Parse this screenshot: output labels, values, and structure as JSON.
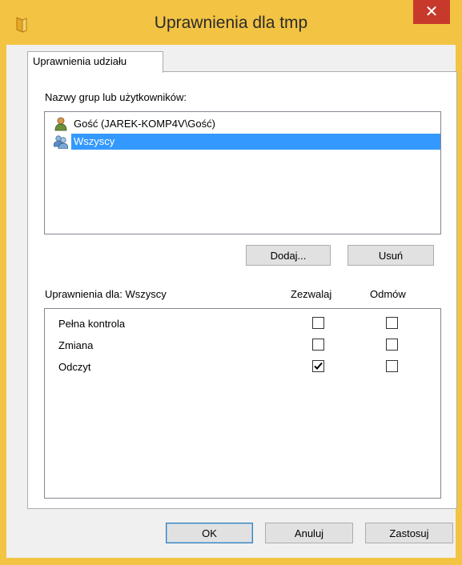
{
  "window": {
    "title": "Uprawnienia dla tmp",
    "close_glyph": "✕",
    "icon": "folder-icon"
  },
  "tabs": [
    {
      "label": "Uprawnienia udziału",
      "selected": true
    }
  ],
  "users_section": {
    "label": "Nazwy grup lub użytkowników:",
    "items": [
      {
        "label": "Gość (JAREK-KOMP4V\\Gość)",
        "icon": "user-icon",
        "selected": false
      },
      {
        "label": "Wszyscy",
        "icon": "group-icon",
        "selected": true
      }
    ],
    "add_label": "Dodaj...",
    "remove_label": "Usuń"
  },
  "permissions": {
    "label": "Uprawnienia dla: Wszyscy",
    "allow_header": "Zezwalaj",
    "deny_header": "Odmów",
    "rows": [
      {
        "name": "Pełna kontrola",
        "allow": false,
        "deny": false
      },
      {
        "name": "Zmiana",
        "allow": false,
        "deny": false
      },
      {
        "name": "Odczyt",
        "allow": true,
        "deny": false
      }
    ]
  },
  "footer": {
    "ok_label": "OK",
    "cancel_label": "Anuluj",
    "apply_label": "Zastosuj"
  },
  "colors": {
    "frame": "#f3c443",
    "close": "#c7392b",
    "selection": "#3399ff"
  }
}
